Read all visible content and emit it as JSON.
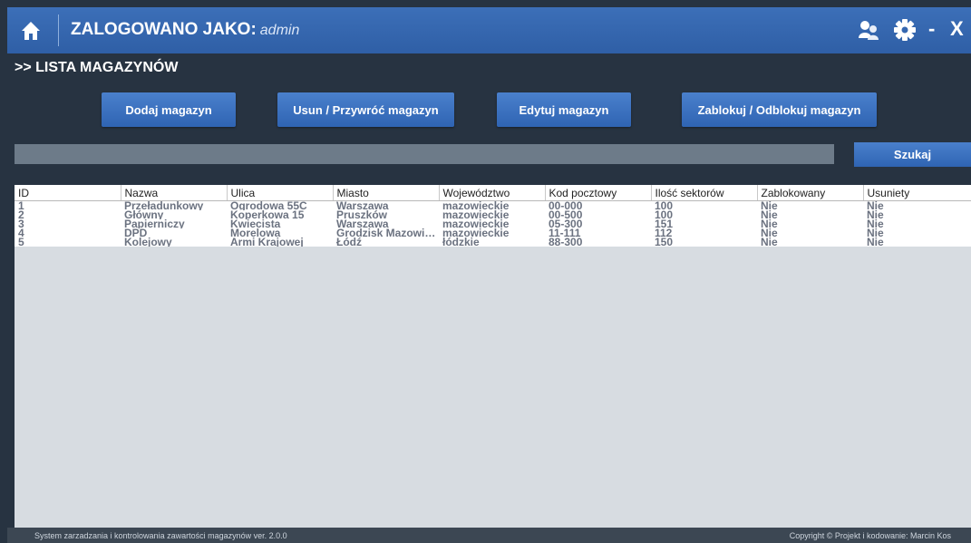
{
  "header": {
    "login_label": "ZALOGOWANO JAKO:",
    "username": "admin",
    "icons": [
      "home-icon",
      "users-icon",
      "gear-icon"
    ],
    "minimize_label": "-",
    "close_label": "X"
  },
  "page_title": ">> LISTA MAGAZYNÓW",
  "toolbar": {
    "add_label": "Dodaj magazyn",
    "delete_label": "Usun / Przywróć magazyn",
    "edit_label": "Edytuj magazyn",
    "block_label": "Zablokuj / Odblokuj magazyn"
  },
  "search": {
    "value": "",
    "button_label": "Szukaj"
  },
  "table": {
    "columns": [
      "ID",
      "Nazwa",
      "Ulica",
      "Miasto",
      "Województwo",
      "Kod pocztowy",
      "Ilość sektorów",
      "Zablokowany",
      "Usuniety"
    ],
    "rows": [
      [
        "1",
        "Przeładunkowy",
        "Ogrodowa 55C",
        "Warszawa",
        "mazowieckie",
        "00-000",
        "100",
        "Nie",
        "Nie"
      ],
      [
        "2",
        "Główny",
        "Koperkowa 15",
        "Pruszków",
        "mazowieckie",
        "00-500",
        "100",
        "Nie",
        "Nie"
      ],
      [
        "3",
        "Papierniczy",
        "Kwiecista",
        "Warszawa",
        "mazowieckie",
        "05-300",
        "151",
        "Nie",
        "Nie"
      ],
      [
        "4",
        "DPD",
        "Morelowa",
        "Grodzisk Mazowie...",
        "mazowieckie",
        "11-111",
        "112",
        "Nie",
        "Nie"
      ],
      [
        "5",
        "Kolejowy",
        "Armi Krajowej",
        "Łódź",
        "łódzkie",
        "88-300",
        "150",
        "Nie",
        "Nie"
      ]
    ]
  },
  "footer": {
    "left": "System zarzadzania i kontrolowania zawartości magazynów ver. 2.0.0",
    "right": "Copyright © Projekt i kodowanie: Marcin Kos"
  },
  "colors": {
    "header_blue": "#3c6fb8",
    "background": "#273341",
    "button_blue": "#3c72c0"
  }
}
